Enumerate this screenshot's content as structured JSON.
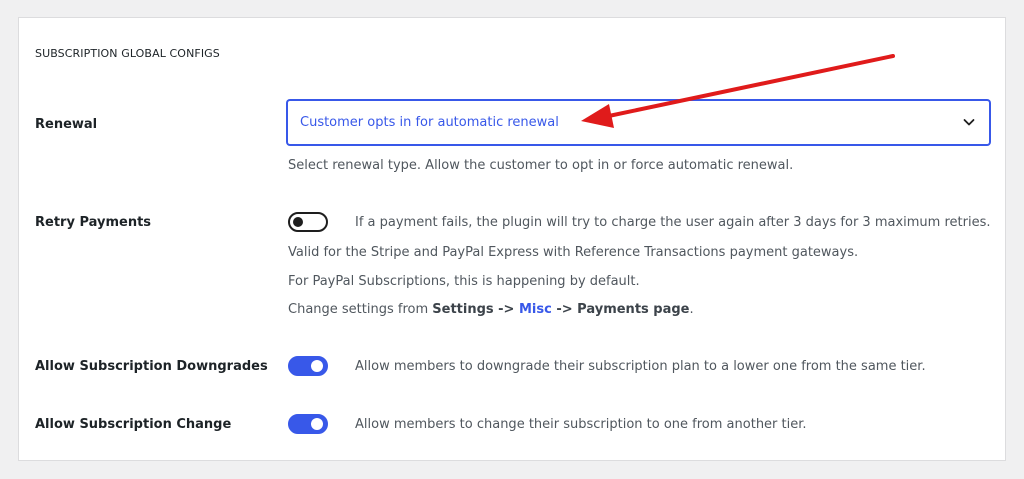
{
  "section": {
    "title": "SUBSCRIPTION GLOBAL CONFIGS"
  },
  "renewal": {
    "label": "Renewal",
    "selected": "Customer opts in for automatic renewal",
    "description": "Select renewal type. Allow the customer to opt in or force automatic renewal."
  },
  "retry": {
    "label": "Retry Payments",
    "enabled": false,
    "description": "If a payment fails, the plugin will try to charge the user again after 3 days for 3 maximum retries.",
    "note1": "Valid for the Stripe and PayPal Express with Reference Transactions payment gateways.",
    "note2": "For PayPal Subscriptions, this is happening by default.",
    "note3_prefix": "Change settings from ",
    "note3_settings": "Settings",
    "note3_sep1": " -> ",
    "note3_misc": "Misc",
    "note3_sep2": " -> ",
    "note3_payments": "Payments page",
    "note3_suffix": "."
  },
  "downgrades": {
    "label": "Allow Subscription Downgrades",
    "enabled": true,
    "description": "Allow members to downgrade their subscription plan to a lower one from the same tier."
  },
  "change": {
    "label": "Allow Subscription Change",
    "enabled": true,
    "description": "Allow members to change their subscription to one from another tier."
  },
  "colors": {
    "accent": "#3858e9",
    "annotation_arrow": "#e01b1b"
  },
  "icons": {
    "select_caret": "chevron-down-icon"
  }
}
